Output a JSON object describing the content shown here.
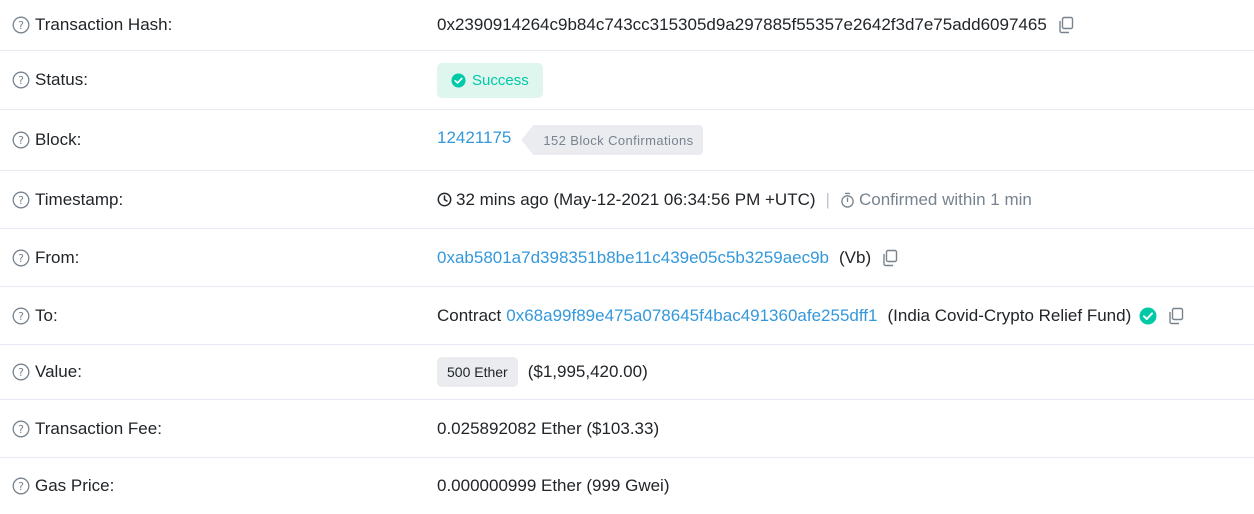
{
  "rows": {
    "hash": {
      "label": "Transaction Hash:",
      "value": "0x2390914264c9b84c743cc315305d9a297885f55357e2642f3d7e75add6097465"
    },
    "status": {
      "label": "Status:",
      "value": "Success"
    },
    "block": {
      "label": "Block:",
      "number": "12421175",
      "confirmations": "152 Block Confirmations"
    },
    "timestamp": {
      "label": "Timestamp:",
      "value": "32 mins ago (May-12-2021 06:34:56 PM +UTC)",
      "separator": "|",
      "confirmed": "Confirmed within 1 min"
    },
    "from": {
      "label": "From:",
      "address": "0xab5801a7d398351b8be11c439e05c5b3259aec9b",
      "tag": "(Vb)"
    },
    "to": {
      "label": "To:",
      "prefix": "Contract",
      "address": "0x68a99f89e475a078645f4bac491360afe255dff1",
      "tag": "(India Covid-Crypto Relief Fund)"
    },
    "value": {
      "label": "Value:",
      "amount": "500 Ether",
      "usd": "($1,995,420.00)"
    },
    "fee": {
      "label": "Transaction Fee:",
      "value": "0.025892082 Ether ($103.33)"
    },
    "gas": {
      "label": "Gas Price:",
      "value": "0.000000999 Ether (999 Gwei)"
    }
  },
  "icons": {
    "help": "question-circle-icon",
    "copy": "copy-icon",
    "success": "check-circle-icon",
    "clock": "clock-icon",
    "timer": "stopwatch-icon",
    "verified": "verified-check-icon"
  },
  "colors": {
    "link": "#3498db",
    "success": "#00c9a7",
    "success_bg": "#dff6ef",
    "muted": "#77838f"
  }
}
